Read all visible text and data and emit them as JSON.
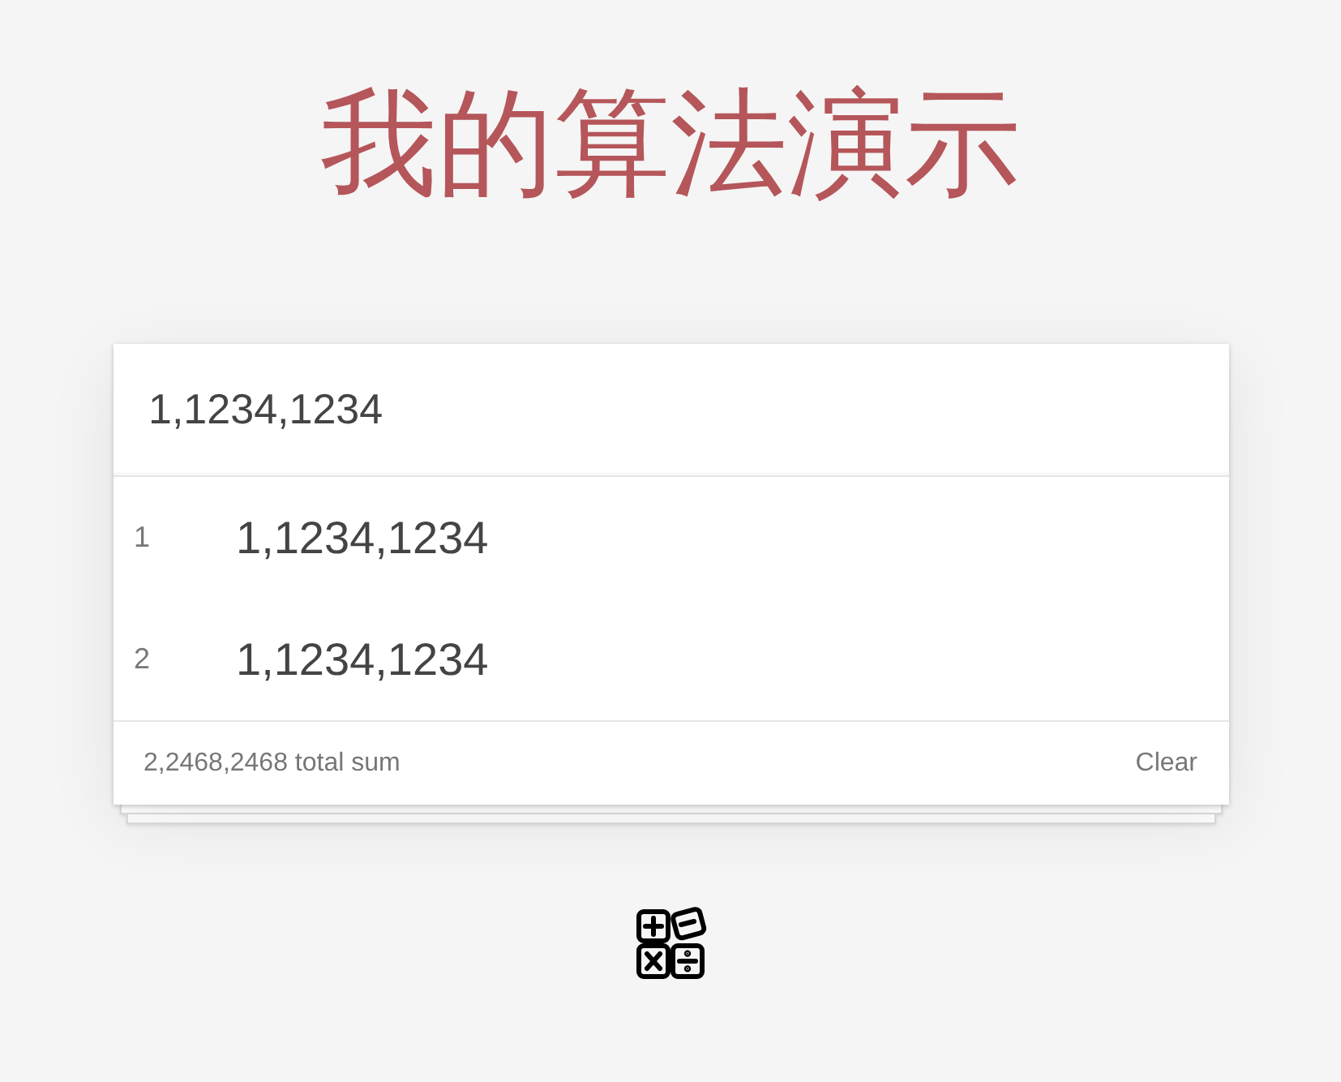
{
  "title": "我的算法演示",
  "input": {
    "value": "1,1234,1234"
  },
  "items": [
    {
      "index": "1",
      "text": "1,1234,1234"
    },
    {
      "index": "2",
      "text": "1,1234,1234"
    }
  ],
  "footer": {
    "total": "2,2468,2468 total sum",
    "clear": "Clear"
  }
}
